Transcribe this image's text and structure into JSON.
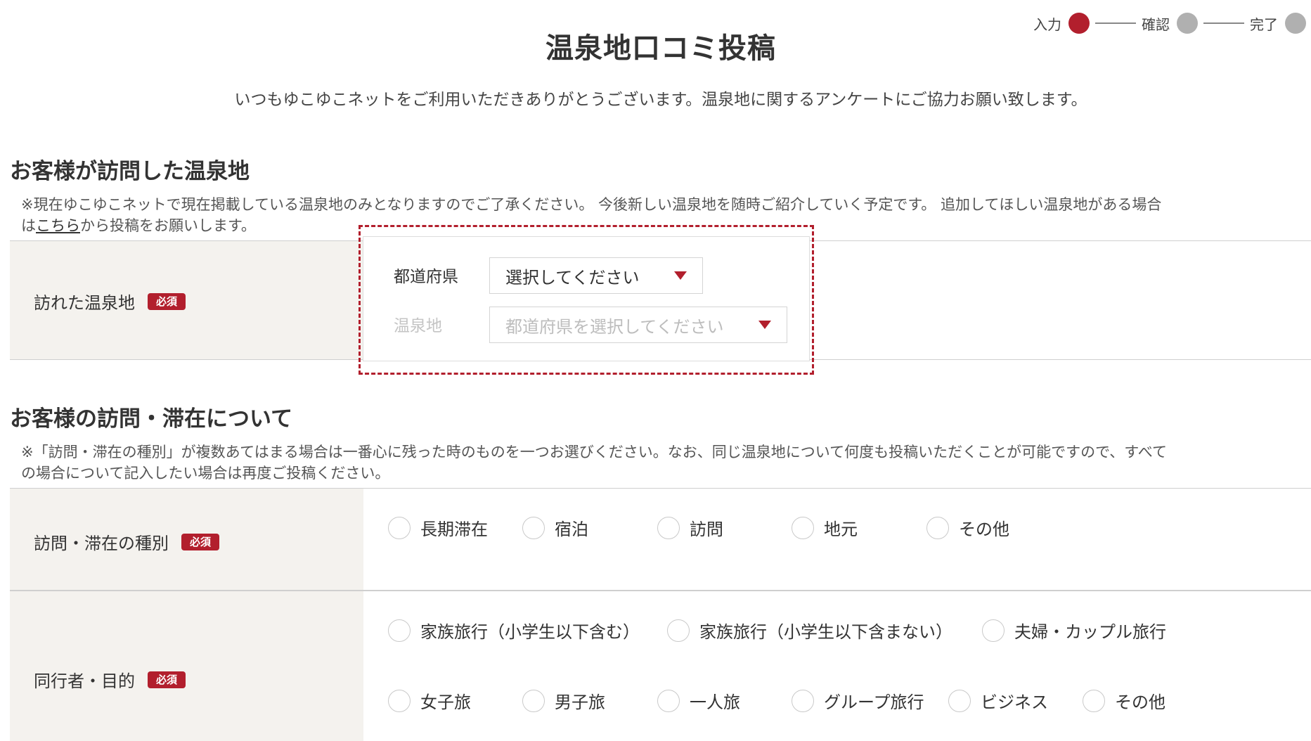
{
  "stepper": {
    "steps": [
      {
        "label": "入力",
        "active": true
      },
      {
        "label": "確認",
        "active": false
      },
      {
        "label": "完了",
        "active": false
      }
    ]
  },
  "page": {
    "title": "温泉地口コミ投稿",
    "intro": "いつもゆこゆこネットをご利用いただきありがとうございます。温泉地に関するアンケートにご協力お願い致します。"
  },
  "section1": {
    "title": "お客様が訪問した温泉地",
    "note_line1": "※現在ゆこゆこネットで現在掲載している温泉地のみとなりますのでご了承ください。 今後新しい温泉地を随時ご紹介していく予定です。 追加してほしい温泉地がある場合",
    "note_line2_prefix": "は",
    "note_link": "こちら",
    "note_line2_suffix": "から投稿をお願いします。",
    "row_label": "訪れた温泉地",
    "required": "必須",
    "prefecture_label": "都道府県",
    "prefecture_value": "選択してください",
    "onsen_label": "温泉地",
    "onsen_placeholder": "都道府県を選択してください"
  },
  "section2": {
    "title": "お客様の訪問・滞在について",
    "note_line1": "※「訪問・滞在の種別」が複数あてはまる場合は一番心に残った時のものを一つお選びください。なお、同じ温泉地について何度も投稿いただくことが可能ですので、すべて",
    "note_line2": "の場合について記入したい場合は再度ご投稿ください。",
    "visit_type_label": "訪問・滞在の種別",
    "visit_type_options": [
      "長期滞在",
      "宿泊",
      "訪問",
      "地元",
      "その他"
    ],
    "companion_label": "同行者・目的",
    "companion_options_row1": [
      "家族旅行（小学生以下含む）",
      "家族旅行（小学生以下含まない）",
      "夫婦・カップル旅行"
    ],
    "companion_options_row2": [
      "女子旅",
      "男子旅",
      "一人旅",
      "グループ旅行",
      "ビジネス",
      "その他"
    ],
    "required": "必須"
  },
  "colors": {
    "accent": "#b21f2d",
    "label_bg": "#f4f2ee",
    "inactive_dot": "#b0b0b0"
  }
}
